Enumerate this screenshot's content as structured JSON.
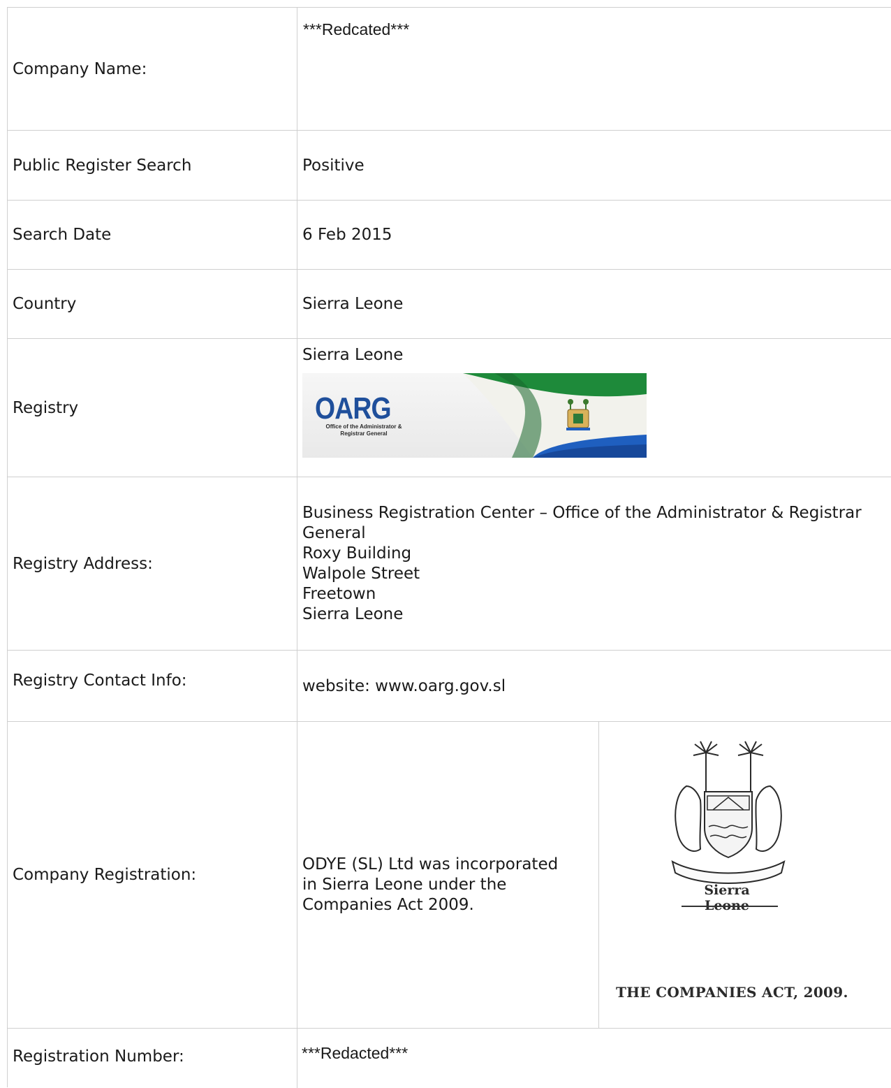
{
  "rows": {
    "company_name": {
      "label": "Company Name:",
      "value": "***Redcated***"
    },
    "public_register_search": {
      "label": "Public Register Search",
      "value": "Positive"
    },
    "search_date": {
      "label": "Search Date",
      "value": "6 Feb 2015"
    },
    "country": {
      "label": "Country",
      "value": "Sierra Leone"
    },
    "registry": {
      "label": "Registry",
      "value": "Sierra Leone",
      "logo_text": "OARG",
      "logo_subtext": "Office of the Administrator & Registrar General"
    },
    "registry_address": {
      "label": "Registry Address:",
      "lines": [
        "Business Registration Center – Office of the Administrator & Registrar",
        "General",
        "Roxy Building",
        "Walpole Street",
        "Freetown",
        "Sierra Leone"
      ]
    },
    "registry_contact": {
      "label": "Registry Contact Info:",
      "value": "website: www.oarg.gov.sl"
    },
    "company_registration": {
      "label": "Company Registration:",
      "lines": [
        "ODYE (SL) Ltd was incorporated",
        "in Sierra Leone under the",
        "Companies Act 2009."
      ],
      "image_caption": "Sierra Leone",
      "image_title": "THE COMPANIES ACT, 2009."
    },
    "registration_number": {
      "label": "Registration Number:",
      "value": "***Redacted***"
    }
  },
  "colors": {
    "border": "#cfcfcf",
    "oarg_blue": "#1f4f9b",
    "flag_green": "#1e8a3a",
    "flag_blue": "#1f5fbf"
  }
}
